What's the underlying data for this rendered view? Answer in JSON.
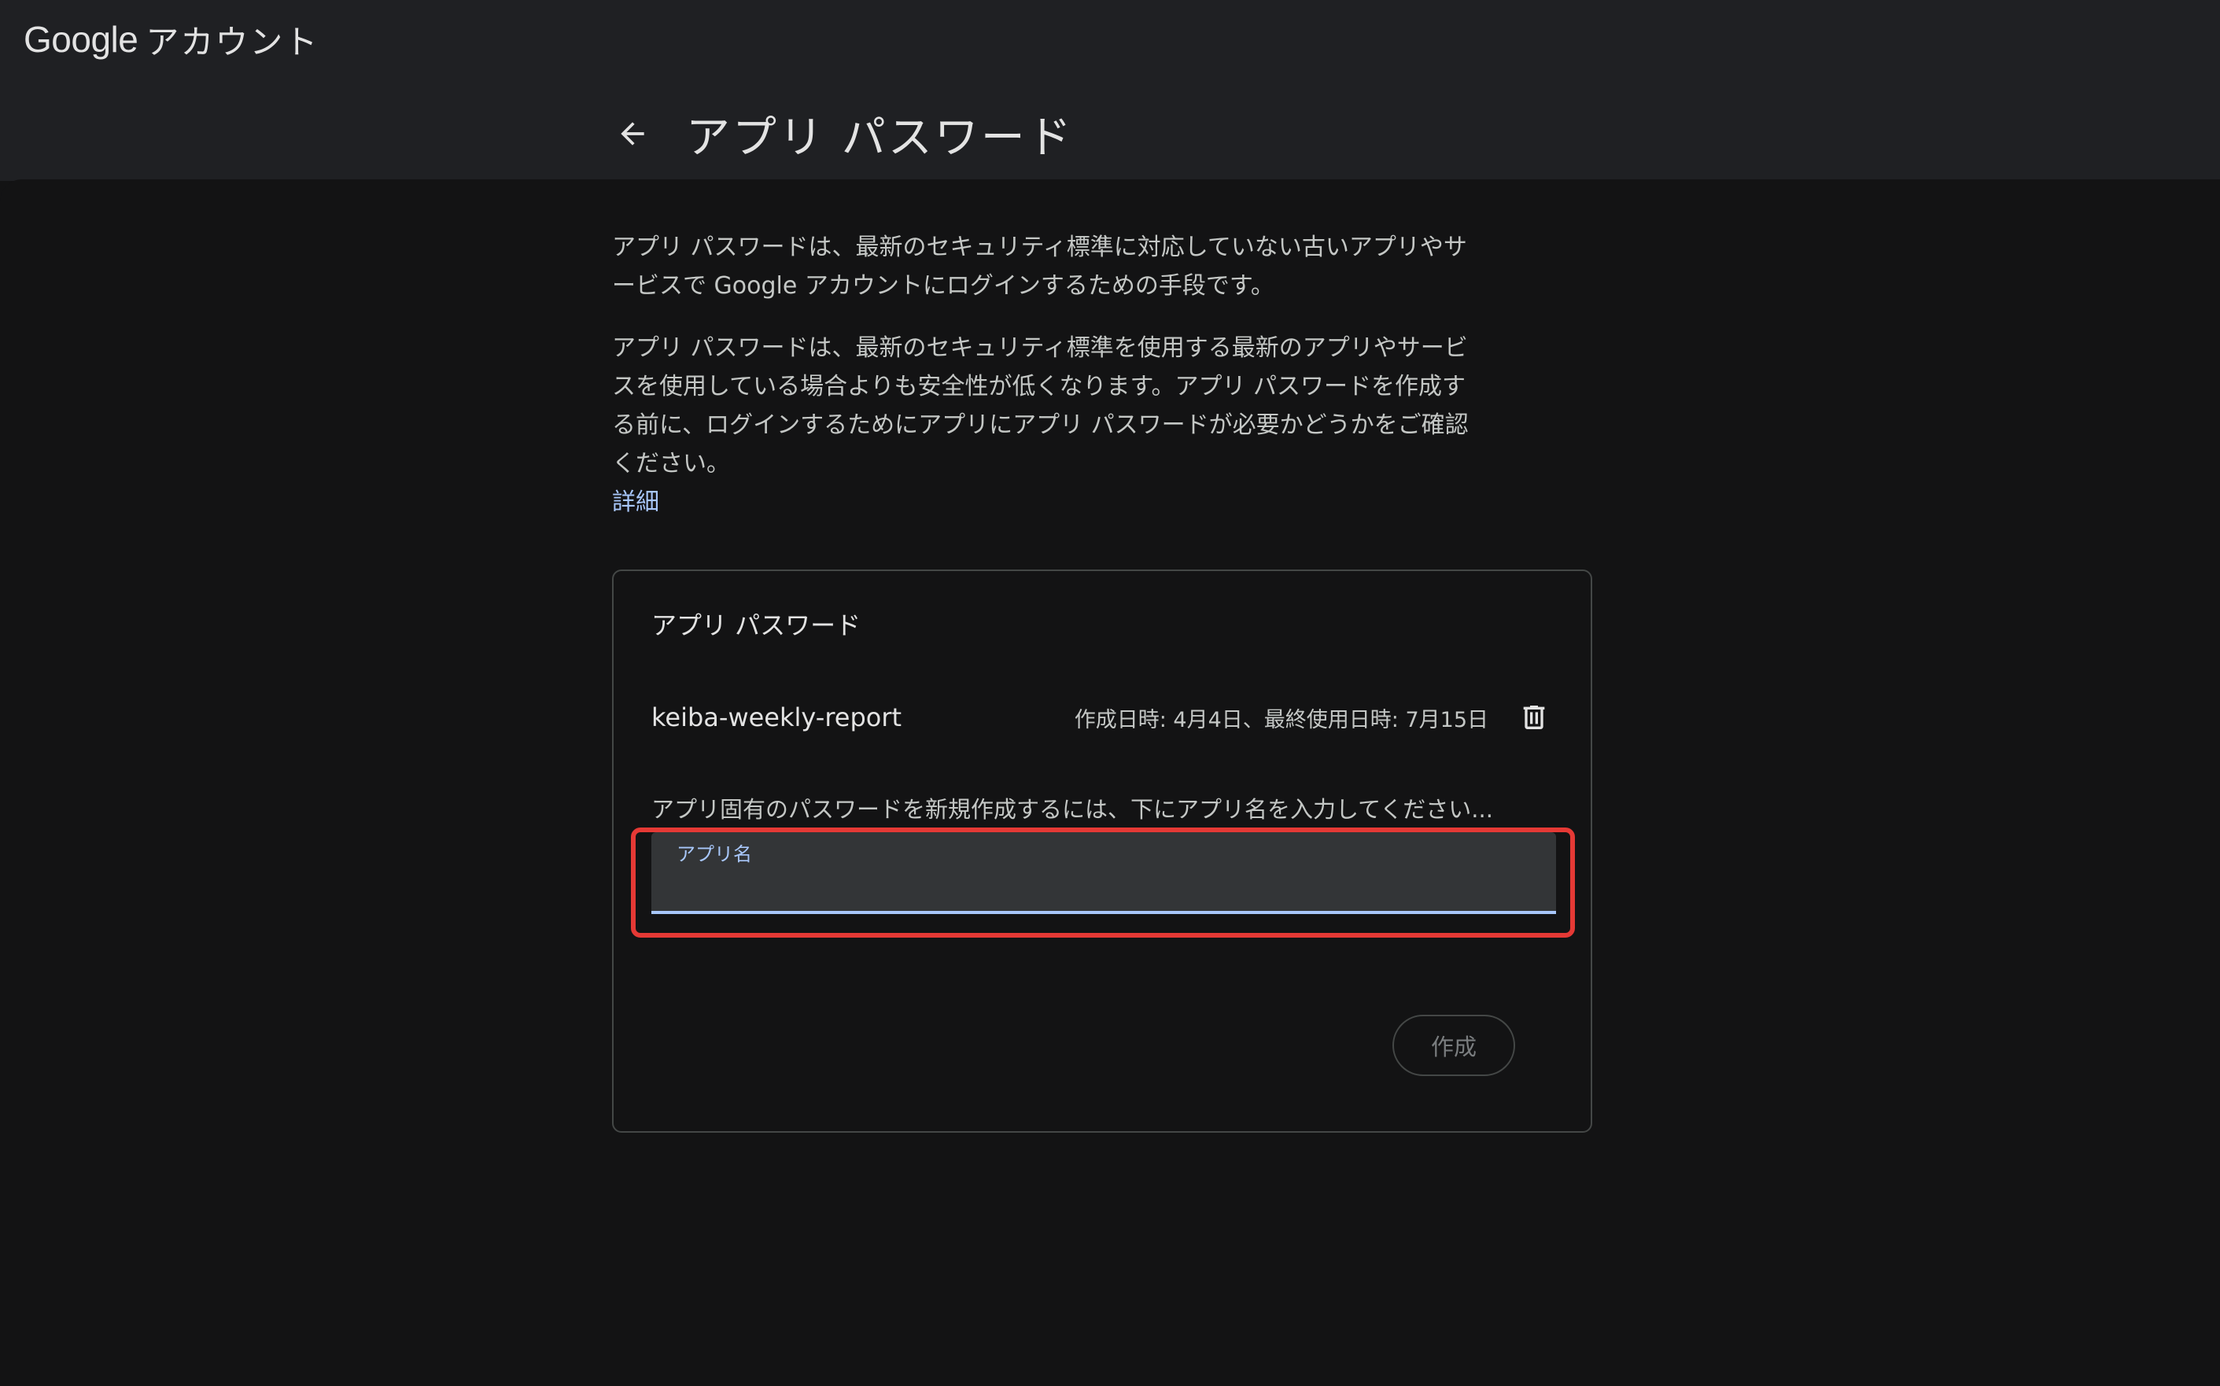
{
  "brand": {
    "google": "Google",
    "account": "アカウント"
  },
  "header": {
    "title": "アプリ パスワード"
  },
  "intro": {
    "paragraph1": "アプリ パスワードは、最新のセキュリティ標準に対応していない古いアプリやサービスで Google アカウントにログインするための手段です。",
    "paragraph2": "アプリ パスワードは、最新のセキュリティ標準を使用する最新のアプリやサービスを使用している場合よりも安全性が低くなります。アプリ パスワードを作成する前に、ログインするためにアプリにアプリ パスワードが必要かどうかをご確認ください。",
    "learn_more": "詳細"
  },
  "card": {
    "title": "アプリ パスワード",
    "passwords": [
      {
        "name": "keiba-weekly-report",
        "meta": "作成日時: 4月4日、最終使用日時: 7月15日"
      }
    ],
    "create_prompt": "アプリ固有のパスワードを新規作成するには、下にアプリ名を入力してください...",
    "field_label": "アプリ名",
    "field_value": "",
    "create_label": "作成"
  },
  "colors": {
    "accent": "#a8c7fa",
    "highlight": "#e53935"
  }
}
